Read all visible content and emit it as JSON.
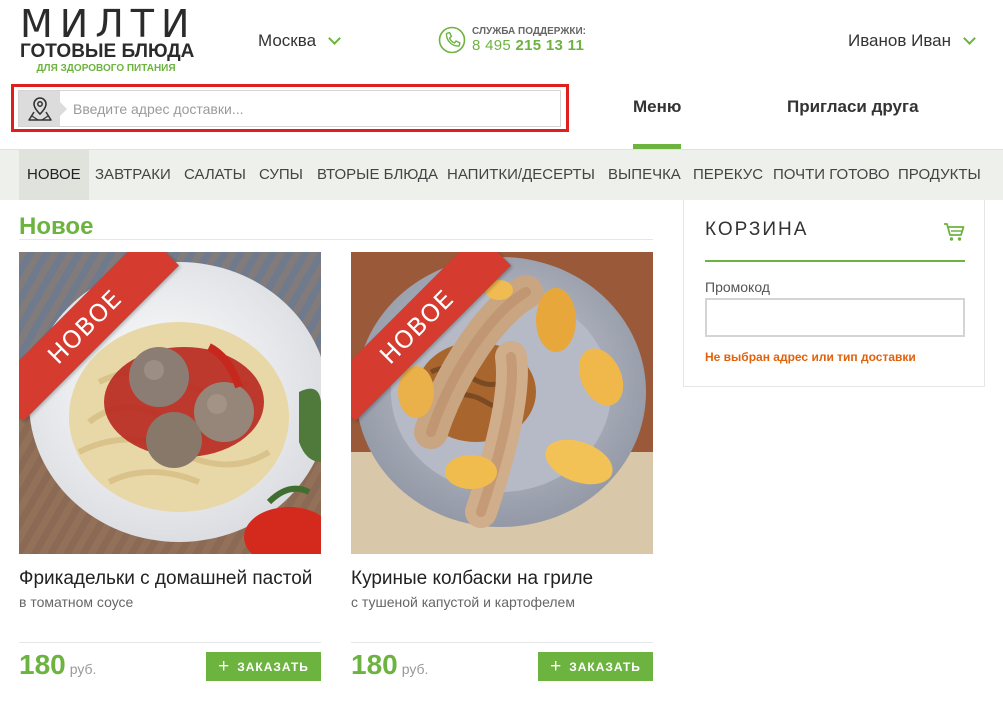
{
  "brand": {
    "name": "МИЛТИ",
    "subtitle": "ГОТОВЫЕ БЛЮДА",
    "tagline": "ДЛЯ ЗДОРОВОГО ПИТАНИЯ",
    "accent_color": "#6db33f"
  },
  "header": {
    "city": "Москва",
    "support_label": "СЛУЖБА ПОДДЕРЖКИ:",
    "support_phone_prefix": "8 495",
    "support_phone_main": "215 13 11",
    "user_name": "Иванов Иван"
  },
  "search": {
    "placeholder": "Введите адрес доставки...",
    "value": ""
  },
  "top_nav": {
    "menu": "Меню",
    "invite": "Пригласи друга"
  },
  "categories": [
    {
      "label": "НОВОЕ",
      "active": true
    },
    {
      "label": "ЗАВТРАКИ"
    },
    {
      "label": "САЛАТЫ"
    },
    {
      "label": "СУПЫ"
    },
    {
      "label": "ВТОРЫЕ БЛЮДА"
    },
    {
      "label": "НАПИТКИ/ДЕСЕРТЫ"
    },
    {
      "label": "ВЫПЕЧКА"
    },
    {
      "label": "ПЕРЕКУС"
    },
    {
      "label": "ПОЧТИ ГОТОВО"
    },
    {
      "label": "ПРОДУКТЫ"
    }
  ],
  "section": {
    "title": "Новое"
  },
  "products": [
    {
      "badge": "НОВОЕ",
      "title": "Фрикадельки с домашней пастой",
      "subtitle": "в томатном соусе",
      "price": "180",
      "currency": "руб.",
      "order_label": "ЗАКАЗАТЬ"
    },
    {
      "badge": "НОВОЕ",
      "title": "Куриные колбаски на гриле",
      "subtitle": "с тушеной капустой и картофелем",
      "price": "180",
      "currency": "руб.",
      "order_label": "ЗАКАЗАТЬ"
    }
  ],
  "cart": {
    "title": "КОРЗИНА",
    "promo_label": "Промокод",
    "promo_value": "",
    "warning": "Не выбран адрес или тип доставки",
    "warning_color": "#e0620b"
  }
}
